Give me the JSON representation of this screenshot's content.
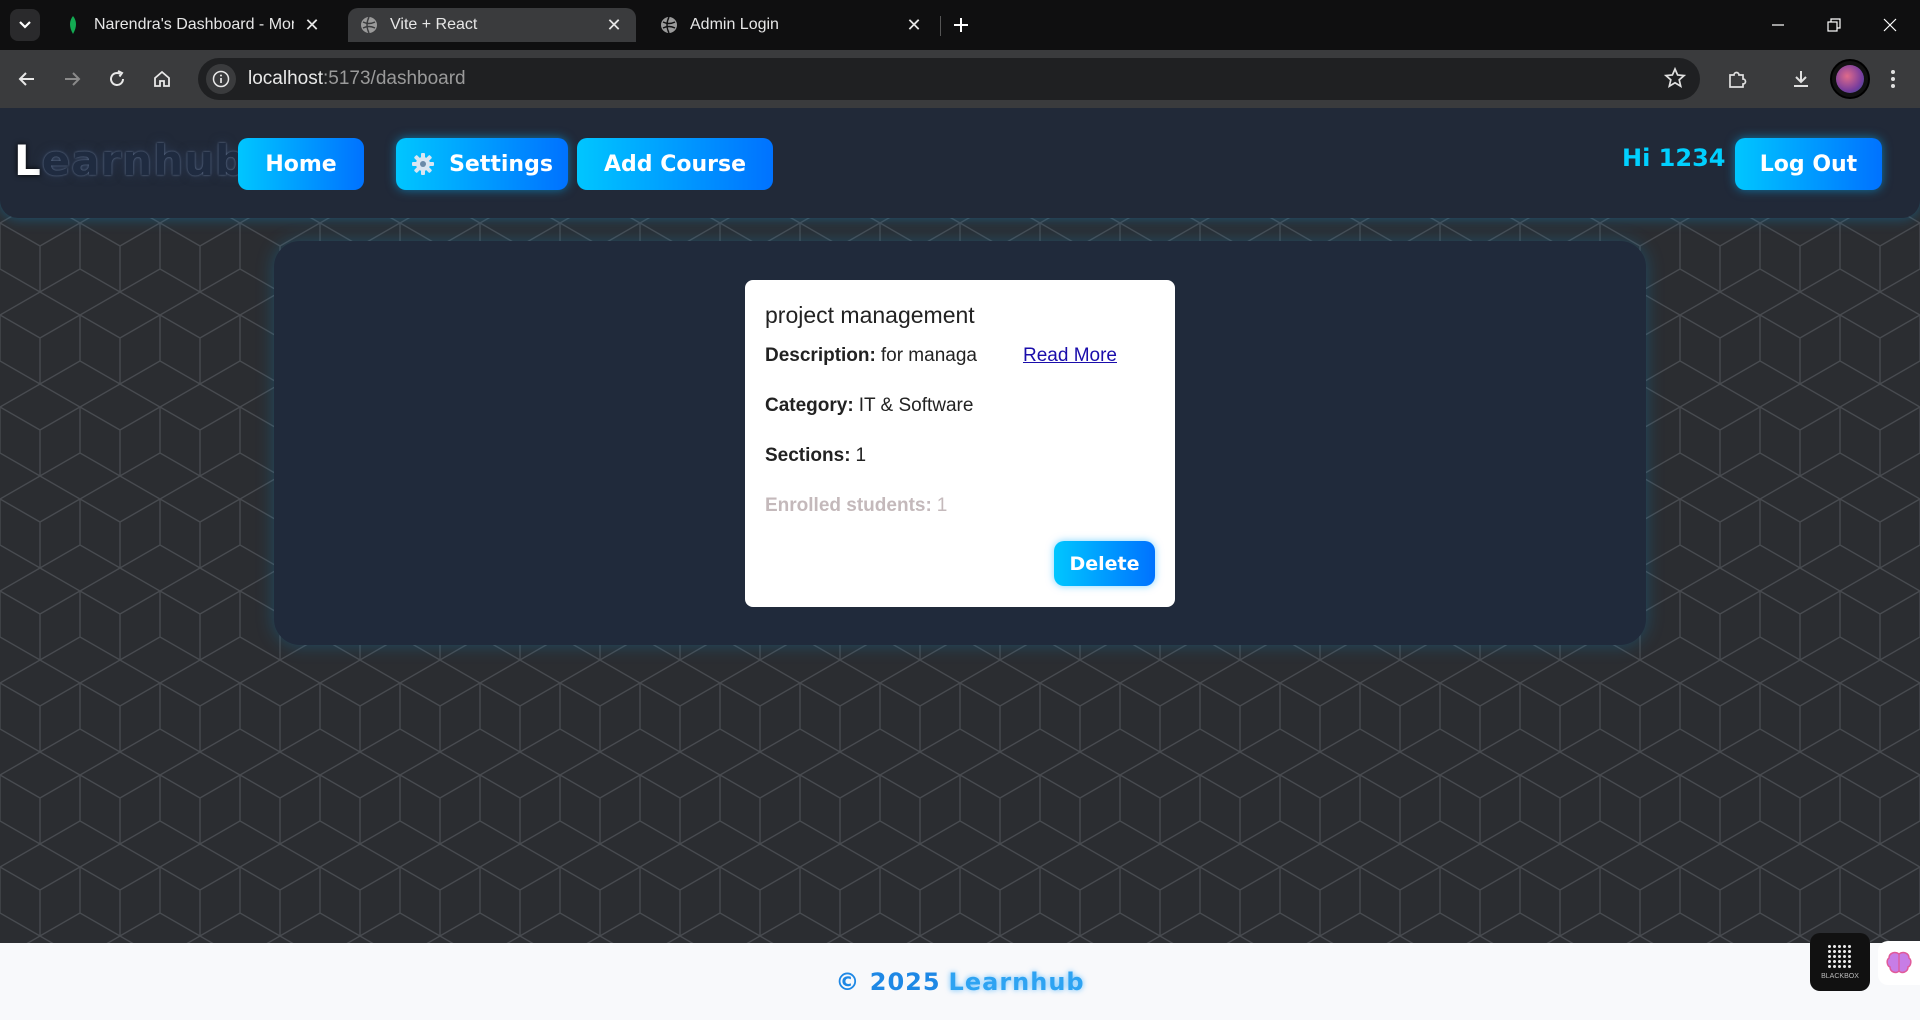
{
  "browser": {
    "tabs": [
      {
        "label": "Narendra's Dashboard - Mongo",
        "active": false
      },
      {
        "label": "Vite + React",
        "active": true
      },
      {
        "label": "Admin Login",
        "active": false
      }
    ],
    "url_host": "localhost",
    "url_path": ":5173/dashboard"
  },
  "header": {
    "logo_first": "L",
    "logo_rest": "earnhub",
    "nav": {
      "home": "Home",
      "settings": "Settings",
      "add_course": "Add Course"
    },
    "greeting": "Hi 1234",
    "logout": "Log Out"
  },
  "course": {
    "title": "project management",
    "description_label": "Description:",
    "description_value": "for managa",
    "read_more": "Read More",
    "category_label": "Category:",
    "category_value": "IT & Software",
    "sections_label": "Sections:",
    "sections_value": "1",
    "enrolled_label": "Enrolled students:",
    "enrolled_value": "1",
    "delete": "Delete"
  },
  "footer": {
    "copyright": "© 2025",
    "brand": "Learnhub"
  },
  "widgets": {
    "blackbox_label": "BLACKBOX"
  },
  "colors": {
    "accent_start": "#00c6ff",
    "accent_end": "#0072ff",
    "header_bg": "#212938",
    "panel_bg": "#202a3b",
    "greeting": "#00d0ff"
  }
}
